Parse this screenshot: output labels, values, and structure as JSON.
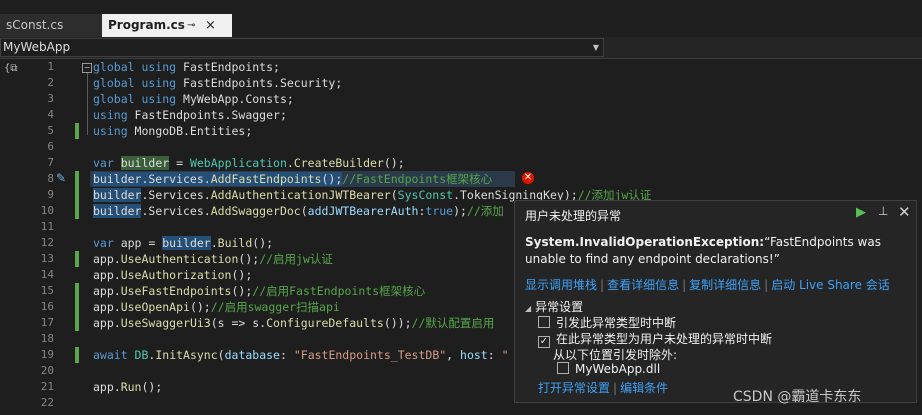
{
  "tabs": {
    "inactive": "sConst.cs",
    "active": "Program.cs",
    "pin_glyph": "⊸",
    "close_glyph": "×"
  },
  "navbar": {
    "project": "MyWebApp"
  },
  "line_numbers": [
    "1",
    "2",
    "3",
    "4",
    "5",
    "6",
    "7",
    "8",
    "9",
    "10",
    "11",
    "12",
    "13",
    "14",
    "15",
    "16",
    "17",
    "18",
    "19",
    "20",
    "21",
    "22"
  ],
  "code": {
    "l1_kw": "global using ",
    "l1_ns": "FastEndpoints;",
    "l2_kw": "global using ",
    "l2_ns": "FastEndpoints.Security;",
    "l3_kw": "global using ",
    "l3_ns": "MyWebApp.Consts;",
    "l4_kw": "using ",
    "l4_ns": "FastEndpoints.Swagger;",
    "l5_kw": "using ",
    "l5_ns": "MongoDB.Entities;",
    "l7_var": "var ",
    "l7_builder": "builder",
    "l7_eq": " = ",
    "l7_type": "WebApplication",
    "l7_dot": ".",
    "l7_fn": "CreateBuilder",
    "l7_end": "();",
    "l8_a": "builder.Services.",
    "l8_fn": "AddFastEndpoints",
    "l8_p": "();",
    "l8_cm": "//FastEndpoints框架核心",
    "l9_b": "builder",
    "l9_a": ".Services.",
    "l9_fn": "AddAuthenticationJWTBearer",
    "l9_p1": "(",
    "l9_ty": "SysConst",
    "l9_p2": ".TokenSigningKey);",
    "l9_cm": "//添加jw认证",
    "l10_b": "builder",
    "l10_a": ".Services.",
    "l10_fn": "AddSwaggerDoc",
    "l10_p1": "(",
    "l10_pn": "addJWTBearerAuth",
    "l10_p2": ":",
    "l10_kw": "true",
    "l10_p3": ");",
    "l10_cm": "//添加",
    "l12_var": "var ",
    "l12_a": "app = ",
    "l12_b": "builder",
    "l12_dot": ".",
    "l12_fn": "Build",
    "l12_end": "();",
    "l13_a": "app.",
    "l13_fn": "UseAuthentication",
    "l13_p": "();",
    "l13_cm": "//启用jw认证",
    "l14_a": "app.",
    "l14_fn": "UseAuthorization",
    "l14_p": "();",
    "l15_a": "app.",
    "l15_fn": "UseFastEndpoints",
    "l15_p": "();",
    "l15_cm": "//启用FastEndpoints框架核心",
    "l16_a": "app.",
    "l16_fn": "UseOpenApi",
    "l16_p": "();",
    "l16_cm": "//启用swagger扫描api",
    "l17_a": "app.",
    "l17_fn": "UseSwaggerUi3",
    "l17_p1": "(s => s.",
    "l17_fn2": "ConfigureDefaults",
    "l17_p2": "());",
    "l17_cm": "//默认配置启用",
    "l19_kw": "await ",
    "l19_ty": "DB",
    "l19_dot": ".",
    "l19_fn": "InitAsync",
    "l19_p1": "(",
    "l19_pn1": "database",
    "l19_p2": ": ",
    "l19_str": "\"FastEndpoints_TestDB\"",
    "l19_p3": ", ",
    "l19_pn2": "host",
    "l19_p4": ": ",
    "l19_str2": "\"",
    "l21_a": "app.",
    "l21_fn": "Run",
    "l21_p": "();"
  },
  "exception_popup": {
    "title": "用户未处理的异常",
    "exception_type": "System.InvalidOperationException:",
    "message": "“FastEndpoints was unable to find any endpoint declarations!”",
    "links": [
      "显示调用堆栈",
      "查看详细信息",
      "复制详细信息",
      "启动 Live Share 会话"
    ],
    "section_title": "异常设置",
    "option_break_when_thrown": "引发此异常类型时中断",
    "option_break_when_unhandled": "在此异常类型为用户未处理的异常时中断",
    "except_when_thrown_from": "从以下位置引发时除外:",
    "exception_source": "MyWebApp.dll",
    "bottom_links": [
      "打开异常设置",
      "编辑条件"
    ],
    "separator": "|"
  },
  "watermark": "CSDN @霸道卡东东"
}
